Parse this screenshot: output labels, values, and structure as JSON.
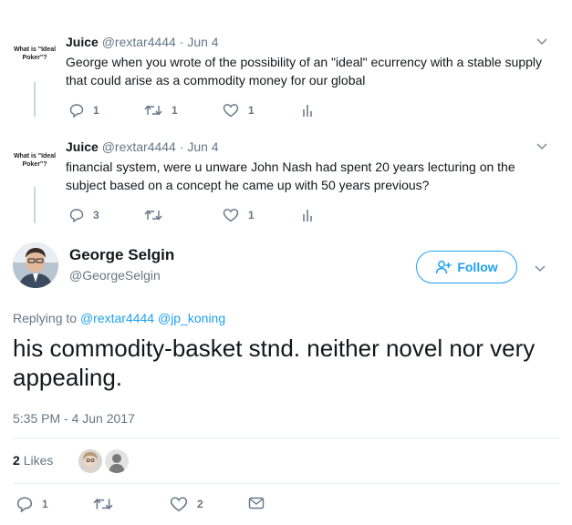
{
  "tweets": [
    {
      "avatar_text": "What is \"Ideal Poker\"?",
      "name": "Juice",
      "handle": "@rextar4444",
      "separator": "·",
      "date": "Jun 4",
      "text": "George when you wrote of the possibility of an \"ideal\" ecurrency with a stable supply that could arise as a commodity money for our global",
      "replies": "1",
      "retweets": "1",
      "likes": "1"
    },
    {
      "avatar_text": "What is \"Ideal Poker\"?",
      "name": "Juice",
      "handle": "@rextar4444",
      "separator": "·",
      "date": "Jun 4",
      "text": "financial system, were u unware John Nash had spent 20 years lecturing on the subject based on a concept he came up with 50 years previous?",
      "replies": "3",
      "retweets": "",
      "likes": "1"
    }
  ],
  "main_tweet": {
    "name": "George Selgin",
    "handle": "@GeorgeSelgin",
    "follow_label": "Follow",
    "replying_to_label": "Replying to",
    "mentions": [
      "@rextar4444",
      "@jp_koning"
    ],
    "text": "his commodity-basket stnd. neither novel nor very appealing.",
    "timestamp": "5:35 PM - 4 Jun 2017",
    "likes_count": "2",
    "likes_label": "Likes",
    "replies": "1",
    "retweets": "",
    "likes": "2"
  },
  "colors": {
    "accent": "#1da1f2",
    "muted": "#657786",
    "text": "#14171a",
    "divider": "#e6ecf0"
  },
  "icons": [
    "reply-icon",
    "retweet-icon",
    "heart-icon",
    "analytics-icon",
    "chevron-down-icon",
    "follow-user-icon",
    "direct-message-icon"
  ]
}
